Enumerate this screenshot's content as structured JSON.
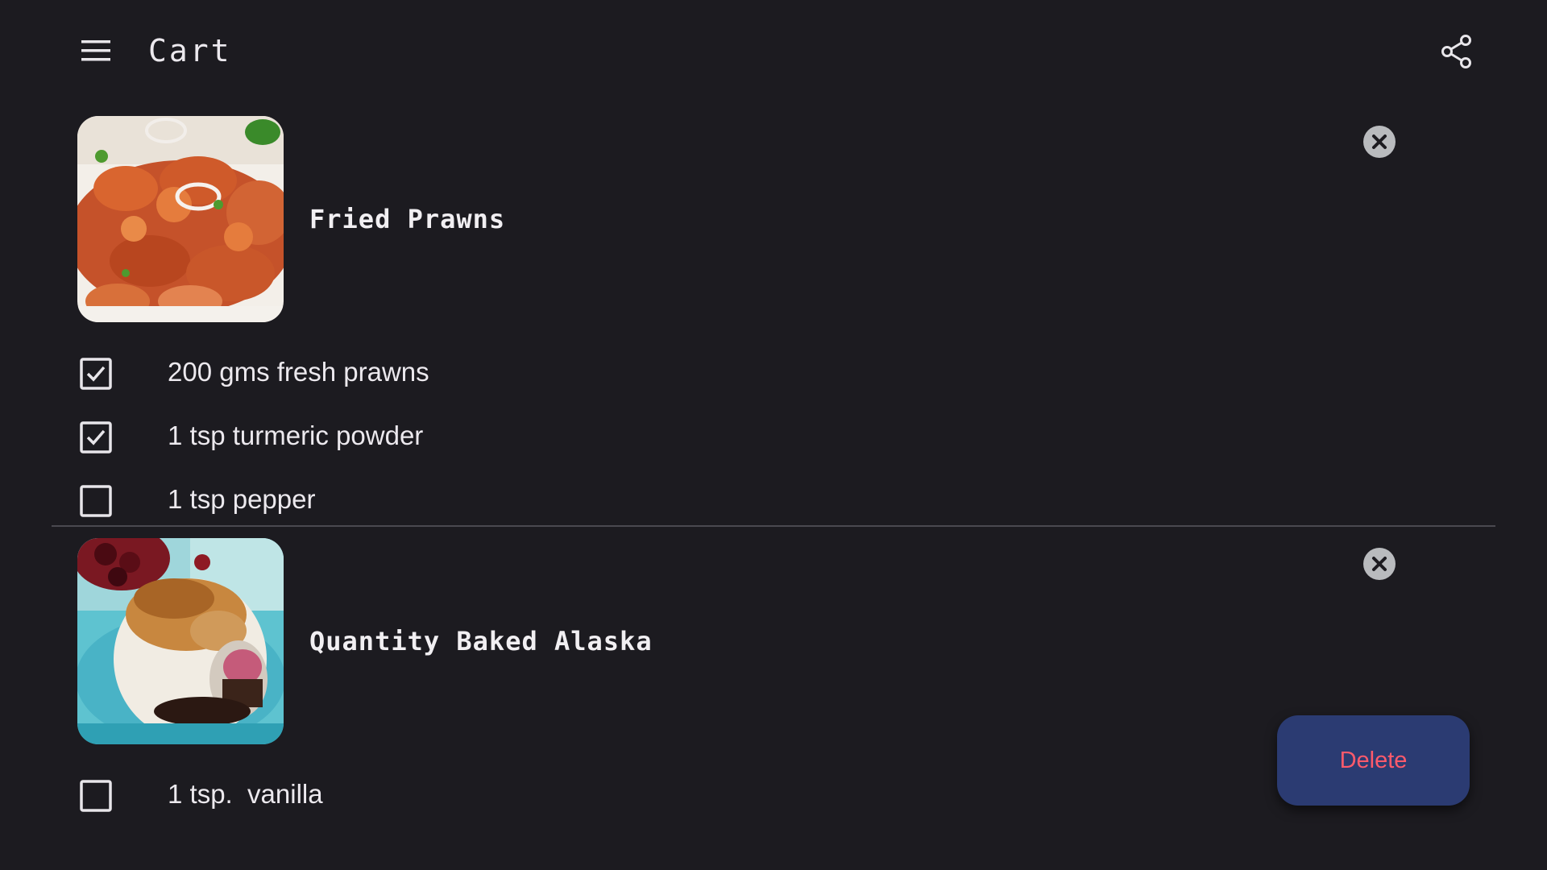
{
  "app": {
    "title": "Cart",
    "menu_icon": "hamburger-menu-icon",
    "share_icon": "share-icon"
  },
  "recipes": [
    {
      "name": "Fried Prawns",
      "image": "fried-prawns-photo",
      "remove_icon": "close-circle-icon",
      "ingredients": [
        {
          "text": "200 gms fresh prawns",
          "checked": true
        },
        {
          "text": "1 tsp turmeric powder",
          "checked": true
        },
        {
          "text": "1 tsp pepper",
          "checked": false
        }
      ]
    },
    {
      "name": "Quantity Baked Alaska",
      "image": "baked-alaska-photo",
      "remove_icon": "close-circle-icon",
      "ingredients": [
        {
          "text": "1 tsp.  vanilla",
          "checked": false
        }
      ]
    }
  ],
  "actions": {
    "delete_label": "Delete"
  },
  "colors": {
    "background": "#1c1b20",
    "fab_background": "#2b3b72",
    "delete_text": "#ff5a6b",
    "remove_button": "#b9bbbe"
  }
}
